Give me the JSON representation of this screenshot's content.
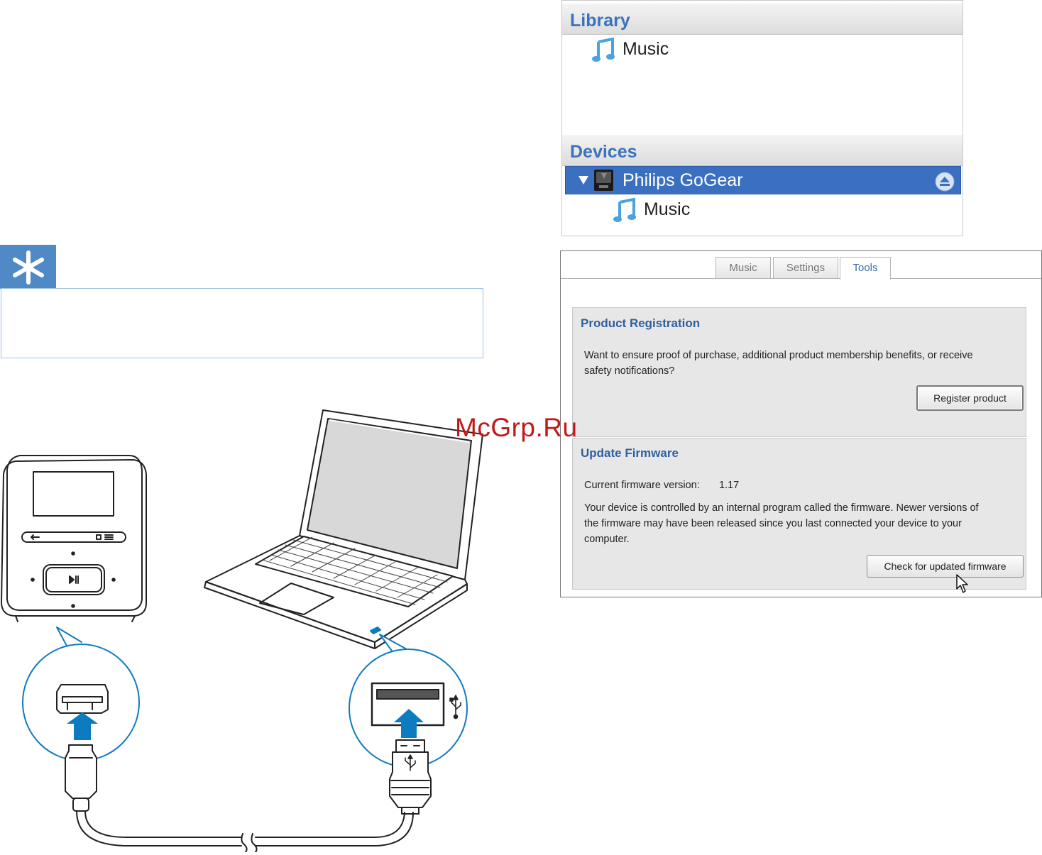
{
  "library_panel": {
    "library_header": "Library",
    "library_item": "Music",
    "devices_header": "Devices",
    "device_name": "Philips GoGear",
    "device_item": "Music"
  },
  "tools_panel": {
    "tabs": [
      "Music",
      "Settings",
      "Tools"
    ],
    "active_tab": "Tools",
    "registration": {
      "title": "Product Registration",
      "text_line1": "Want to ensure proof of purchase, additional product membership benefits, or receive",
      "text_line2": "safety notifications?",
      "button": "Register product"
    },
    "firmware": {
      "title": "Update Firmware",
      "version_label": "Current firmware version:",
      "version_value": "1.17",
      "text_line1": "Your device is controlled by an internal program called the firmware. Newer versions of",
      "text_line2": "the firmware may have been released since you last connected your device to your",
      "text_line3": "computer.",
      "button": "Check for updated firmware"
    }
  },
  "watermark": "McGrp.Ru",
  "colors": {
    "accent_blue": "#3a73bb",
    "selection_blue": "#3b70c0",
    "tip_blue": "#4f89c6",
    "connector_blue": "#0d7bbf",
    "watermark_red": "#c11818"
  }
}
